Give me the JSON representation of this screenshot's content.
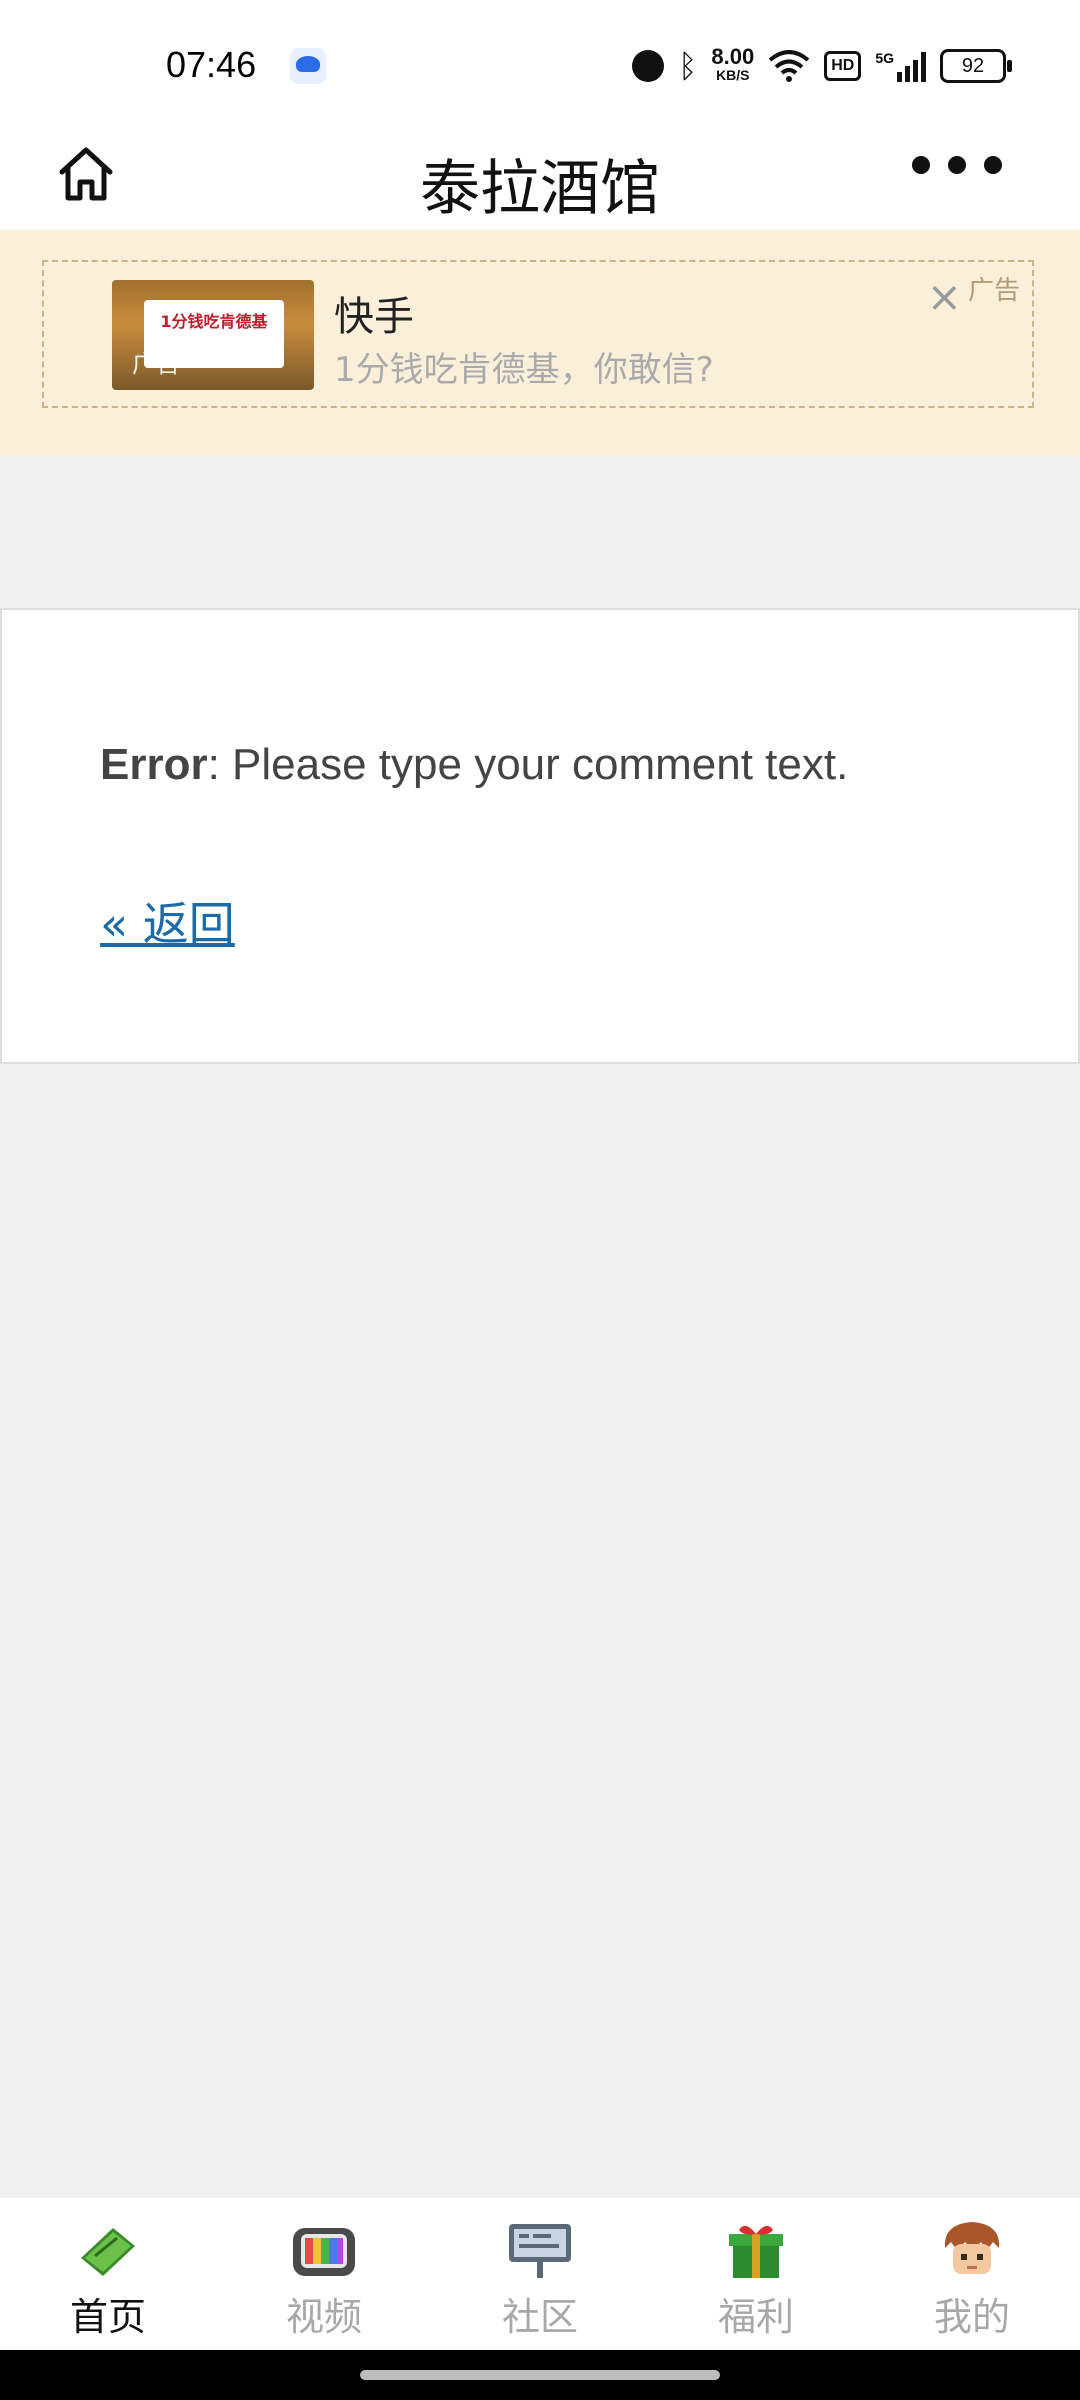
{
  "status": {
    "time": "07:46",
    "net_speed_value": "8.00",
    "net_speed_unit": "KB/S",
    "hd": "HD",
    "signal_label": "5G",
    "battery": "92"
  },
  "header": {
    "title": "泰拉酒馆"
  },
  "ad": {
    "thumb_text": "1分钱吃肯德基",
    "thumb_tag": "广告",
    "title": "快手",
    "description": "1分钱吃肯德基，你敢信?",
    "label": "广告",
    "close_icon": "×"
  },
  "content": {
    "error_label": "Error",
    "error_message": ": Please type your comment text.",
    "back_link": "« 返回"
  },
  "tabs": [
    {
      "label": "首页",
      "icon": "book-icon"
    },
    {
      "label": "视频",
      "icon": "tv-icon"
    },
    {
      "label": "社区",
      "icon": "sign-icon"
    },
    {
      "label": "福利",
      "icon": "gift-icon"
    },
    {
      "label": "我的",
      "icon": "avatar-icon"
    }
  ],
  "colors": {
    "ad_bg": "#faf0da",
    "link": "#1c6aa8",
    "page_bg": "#f0f0f0"
  }
}
